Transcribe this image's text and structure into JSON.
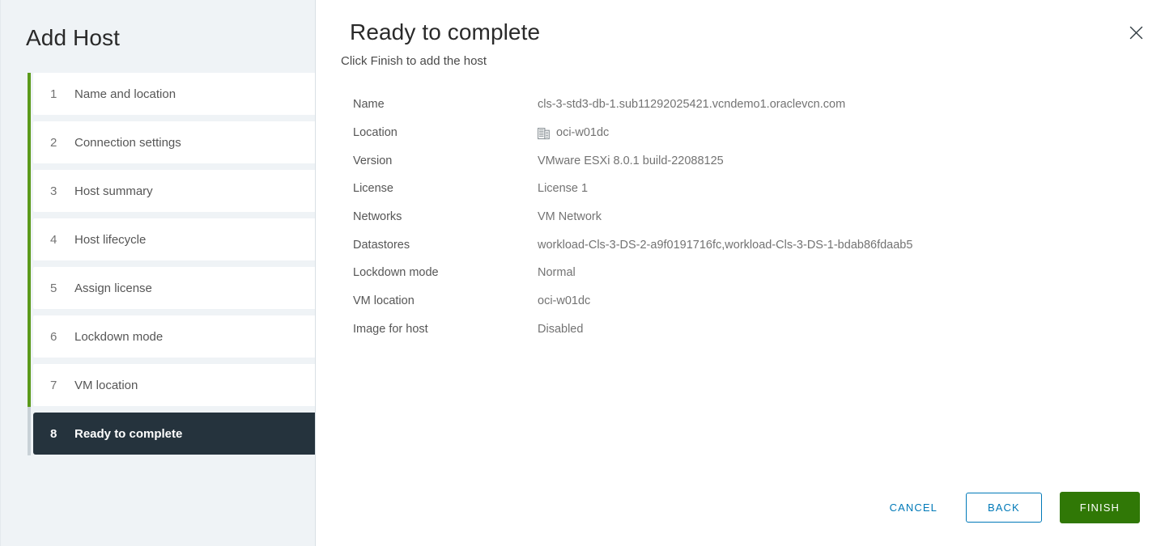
{
  "wizard": {
    "sidebar_title": "Add Host",
    "steps": [
      {
        "num": "1",
        "label": "Name and location",
        "active": false
      },
      {
        "num": "2",
        "label": "Connection settings",
        "active": false
      },
      {
        "num": "3",
        "label": "Host summary",
        "active": false
      },
      {
        "num": "4",
        "label": "Host lifecycle",
        "active": false
      },
      {
        "num": "5",
        "label": "Assign license",
        "active": false
      },
      {
        "num": "6",
        "label": "Lockdown mode",
        "active": false
      },
      {
        "num": "7",
        "label": "VM location",
        "active": false
      },
      {
        "num": "8",
        "label": "Ready to complete",
        "active": true
      }
    ]
  },
  "main": {
    "title": "Ready to complete",
    "subtitle": "Click Finish to add the host",
    "close_icon": "close-icon",
    "summary": [
      {
        "key": "Name",
        "value": "cls-3-std3-db-1.sub11292025421.vcndemo1.oraclevcn.com",
        "icon": ""
      },
      {
        "key": "Location",
        "value": "oci-w01dc",
        "icon": "datacenter-icon"
      },
      {
        "key": "Version",
        "value": "VMware ESXi 8.0.1 build-22088125",
        "icon": ""
      },
      {
        "key": "License",
        "value": "License 1",
        "icon": ""
      },
      {
        "key": "Networks",
        "value": "VM Network",
        "icon": ""
      },
      {
        "key": "Datastores",
        "value": "workload-Cls-3-DS-2-a9f0191716fc,workload-Cls-3-DS-1-bdab86fdaab5",
        "icon": ""
      },
      {
        "key": "Lockdown mode",
        "value": "Normal",
        "icon": ""
      },
      {
        "key": "VM location",
        "value": "oci-w01dc",
        "icon": ""
      },
      {
        "key": "Image for host",
        "value": "Disabled",
        "icon": ""
      }
    ]
  },
  "footer": {
    "cancel_label": "CANCEL",
    "back_label": "BACK",
    "finish_label": "FINISH"
  },
  "colors": {
    "progress_complete": "#5b9a1b",
    "progress_remaining": "#c8d1d7",
    "active_step_bg": "#25333d",
    "sidebar_bg": "#eff3f6",
    "link_blue": "#0079b8",
    "finish_green": "#307806"
  }
}
